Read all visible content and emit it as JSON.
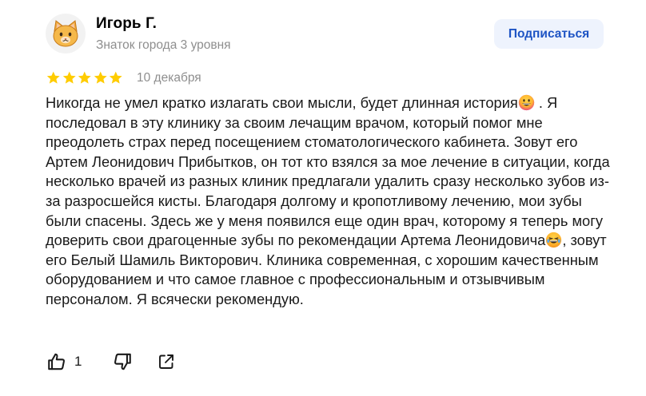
{
  "author": {
    "name": "Игорь Г.",
    "level": "Знаток города 3 уровня",
    "avatar_icon": "cat-avatar-icon"
  },
  "subscribe": {
    "label": "Подписаться"
  },
  "rating": {
    "stars": 5,
    "max": 5,
    "color": "#fc0"
  },
  "date": "10 декабря",
  "review": {
    "segments": [
      {
        "text": "Никогда не умел кратко излагать свои мысли, будет длинная история"
      },
      {
        "emoji": "grinning-face-icon"
      },
      {
        "text": " . Я последовал в эту клинику за своим лечащим врачом, который помог мне преодолеть страх перед посещением стоматологического кабинета. Зовут его Артем Леонидович Прибытков, он тот кто взялся за мое лечение в ситуации, когда несколько врачей из разных клиник предлагали удалить сразу несколько зубов из-за разросшейся кисты. Благодаря долгому и кропотливому лечению, мои зубы были спасены. Здесь же у меня появился еще один врач, которому я теперь могу доверить свои драгоценные зубы по рекомендации Артема Леонидовича"
      },
      {
        "emoji": "laughing-face-icon"
      },
      {
        "text": ", зовут его Белый Шамиль Викторович. Клиника современная, с хорошим качественным оборудованием и что самое главное с профессиональным и отзывчивым персоналом. Я всячески рекомендую."
      }
    ]
  },
  "actions": {
    "like_icon": "thumb-up-icon",
    "like_count": "1",
    "dislike_icon": "thumb-down-icon",
    "share_icon": "share-icon"
  },
  "colors": {
    "accent": "#1e54c4",
    "accent_bg": "#eef3fd",
    "muted": "#8e8e8e",
    "star": "#fc0"
  }
}
